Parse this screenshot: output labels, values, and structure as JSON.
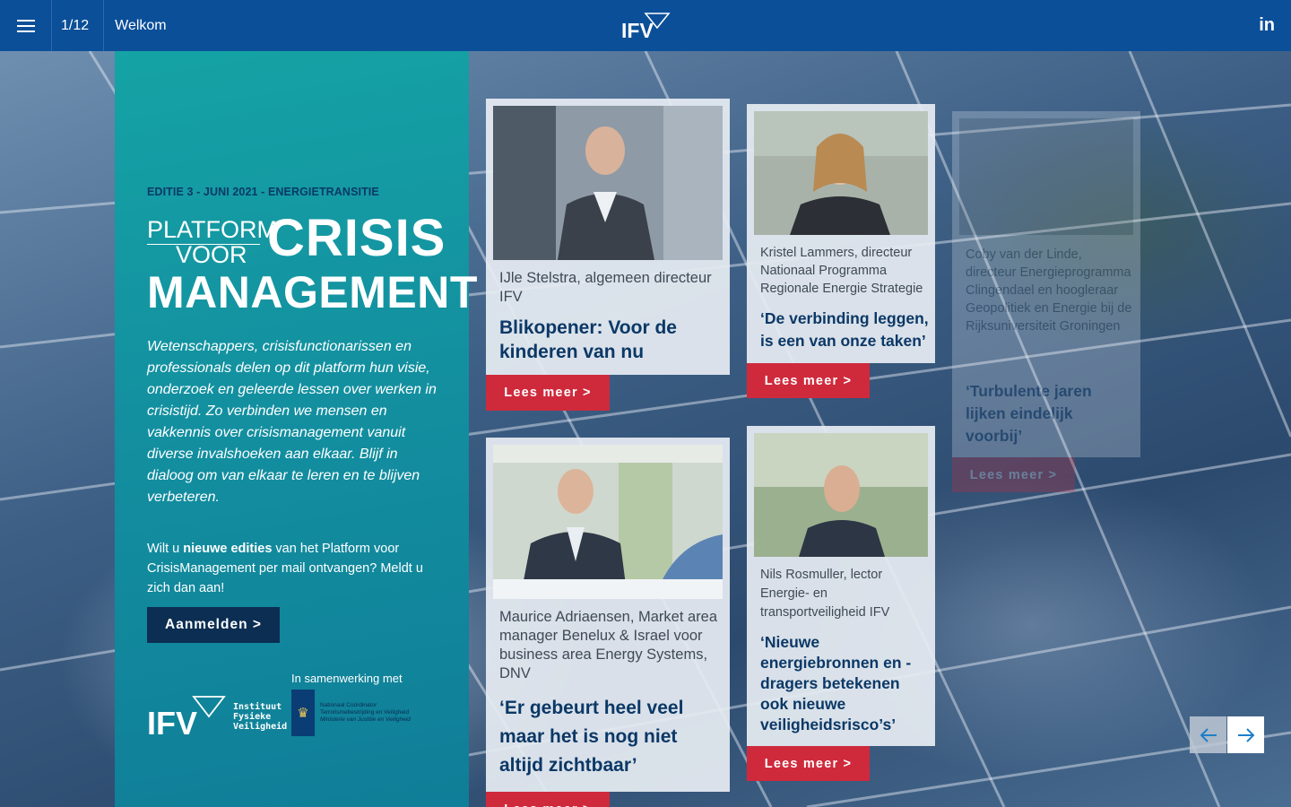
{
  "topbar": {
    "page_counter": "1/12",
    "page_title": "Welkom",
    "logo_text": "IFV",
    "social_label": "in"
  },
  "panel": {
    "edition": "EDITIE 3 - JUNI 2021 - ENERGIETRANSITIE",
    "brand": {
      "line1_small": "PLATFORM",
      "line2_small": "VOOR",
      "line1_big": "CRISIS",
      "line2_big": "MANAGEMENT"
    },
    "intro": "Wetenschappers, crisisfunctionarissen en professionals delen op dit platform hun visie, onderzoek en geleerde lessen over werken in crisistijd. Zo verbinden we mensen en vakkennis over crisismanagement vanuit diverse invalshoeken aan elkaar. Blijf in dialoog om van elkaar te leren en te blijven verbeteren.",
    "signup_pre": "Wilt u ",
    "signup_bold": "nieuwe edities",
    "signup_post": " van het Platform voor CrisisManagement per mail ontvangen? Meldt u zich dan aan!",
    "signup_button": "Aanmelden >",
    "collab_label": "In samenwerking met",
    "ifv_logo": "IFV",
    "ifv_sub": [
      "Instituut",
      "Fysieke",
      "Veiligheid"
    ],
    "nctv_lines": [
      "Nationaal Coördinator",
      "Terrorismebestrijding en Veiligheid",
      "Ministerie van Justitie en Veiligheid"
    ]
  },
  "articles": [
    {
      "author": "IJle Stelstra, algemeen directeur IFV",
      "headline": "Blikopener: Voor de kinderen van nu",
      "button": "Lees meer >"
    },
    {
      "author": "Kristel Lammers, directeur Nationaal Programma Regionale Energie Strategie",
      "headline": "‘De verbinding leggen, is een van onze taken’",
      "button": "Lees meer >"
    },
    {
      "author": "Coby van der Linde, directeur Energieprogramma Clingendael en hoogleraar Geopolitiek en Energie bij de Rijksuniversiteit Groningen",
      "headline": "‘Turbulente jaren lijken eindelijk voorbij’",
      "button": "Lees meer >"
    },
    {
      "author": "Maurice Adriaensen, Market area manager Benelux & Israel voor business area Energy Systems, DNV",
      "headline": "‘Er gebeurt heel veel maar het is nog niet altijd zichtbaar’",
      "button": "Lees meer >"
    },
    {
      "author": "Nils Rosmuller, lector Energie- en transportveiligheid IFV",
      "headline": "‘Nieuwe energiebronnen en -dragers betekenen ook nieuwe veiligheidsrisco’s’",
      "button": "Lees meer >"
    }
  ],
  "icons": {
    "menu": "menu-icon",
    "linkedin": "linkedin-icon",
    "prev": "arrow-left-icon",
    "next": "arrow-right-icon"
  },
  "colors": {
    "topbar": "#0b4f99",
    "panel": "#15a3a5",
    "button_red": "#cf2a3c",
    "signup_dark": "#0c2e52",
    "headline": "#0b3866"
  }
}
